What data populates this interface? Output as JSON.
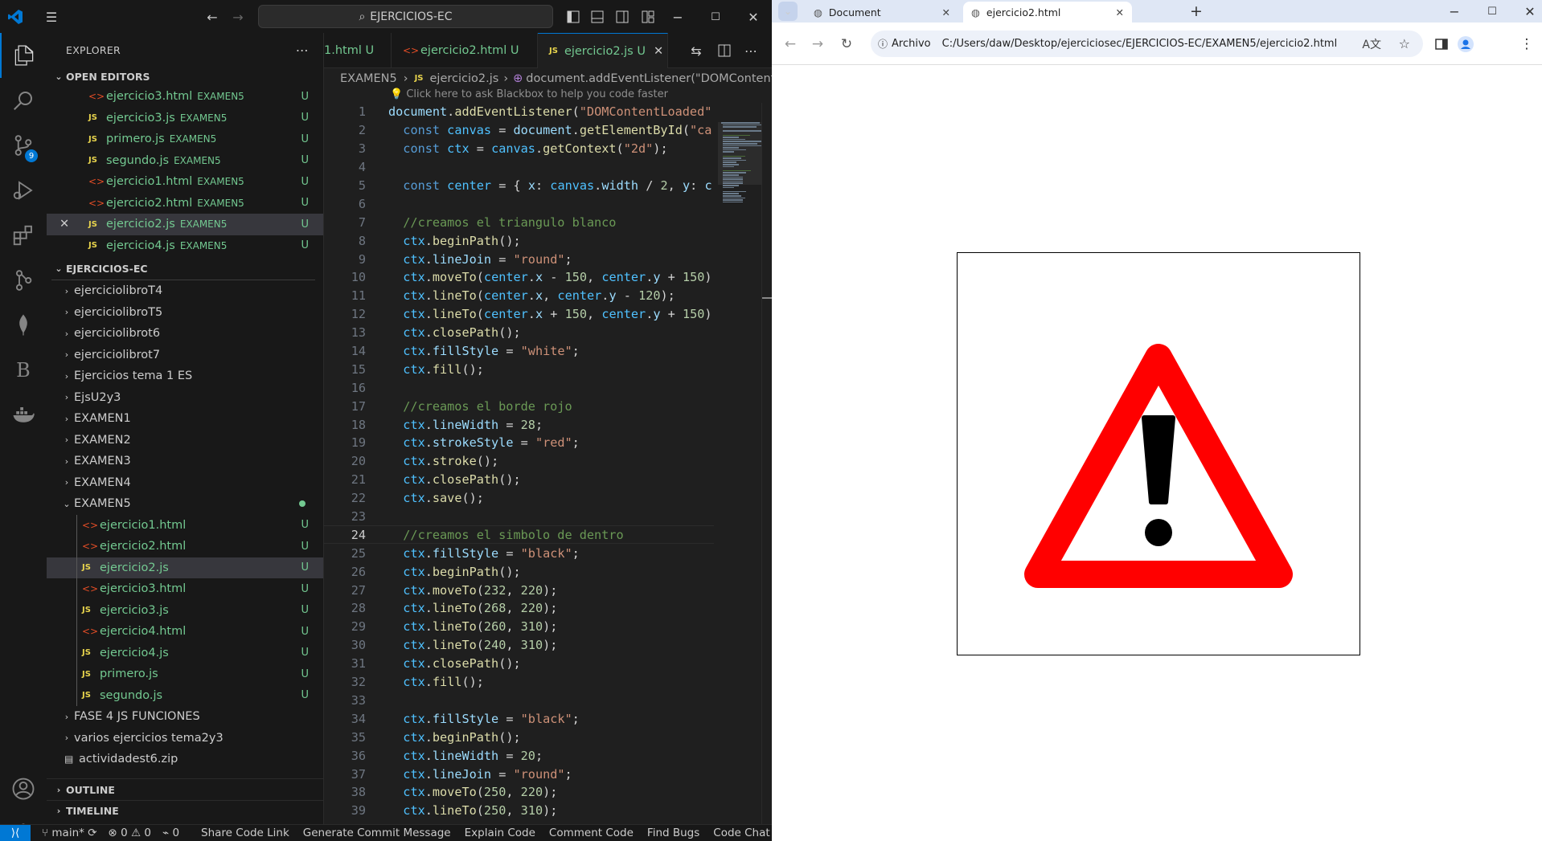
{
  "vscode": {
    "search_label": "EJERCICIOS-EC",
    "sidebar_title": "EXPLORER",
    "open_editors_title": "OPEN EDITORS",
    "open_editors": [
      {
        "name": "ejercicio3.html",
        "dir": "EXAMEN5",
        "type": "html",
        "status": "U"
      },
      {
        "name": "ejercicio3.js",
        "dir": "EXAMEN5",
        "type": "js",
        "status": "U"
      },
      {
        "name": "primero.js",
        "dir": "EXAMEN5",
        "type": "js",
        "status": "U"
      },
      {
        "name": "segundo.js",
        "dir": "EXAMEN5",
        "type": "js",
        "status": "U"
      },
      {
        "name": "ejercicio1.html",
        "dir": "EXAMEN5",
        "type": "html",
        "status": "U"
      },
      {
        "name": "ejercicio2.html",
        "dir": "EXAMEN5",
        "type": "html",
        "status": "U"
      },
      {
        "name": "ejercicio2.js",
        "dir": "EXAMEN5",
        "type": "js",
        "status": "U"
      },
      {
        "name": "ejercicio4.js",
        "dir": "EXAMEN5",
        "type": "js",
        "status": "U"
      }
    ],
    "workspace_title": "EJERCICIOS-EC",
    "folders": [
      "ejerciciolibroT4",
      "ejerciciolibroT5",
      "ejerciciolibrot6",
      "ejerciciolibrot7",
      "Ejercicios tema 1 ES",
      "EjsU2y3",
      "EXAMEN1",
      "EXAMEN2",
      "EXAMEN3",
      "EXAMEN4"
    ],
    "examen5": "EXAMEN5",
    "examen5_files": [
      {
        "name": "ejercicio1.html",
        "type": "html",
        "status": "U"
      },
      {
        "name": "ejercicio2.html",
        "type": "html",
        "status": "U"
      },
      {
        "name": "ejercicio2.js",
        "type": "js",
        "status": "U"
      },
      {
        "name": "ejercicio3.html",
        "type": "html",
        "status": "U"
      },
      {
        "name": "ejercicio3.js",
        "type": "js",
        "status": "U"
      },
      {
        "name": "ejercicio4.html",
        "type": "html",
        "status": "U"
      },
      {
        "name": "ejercicio4.js",
        "type": "js",
        "status": "U"
      },
      {
        "name": "primero.js",
        "type": "js",
        "status": "U"
      },
      {
        "name": "segundo.js",
        "type": "js",
        "status": "U"
      }
    ],
    "folders_after": [
      "FASE 4 JS FUNCIONES",
      "varios ejercicios tema2y3"
    ],
    "zip_file": "actividadest6.zip",
    "outline_title": "OUTLINE",
    "timeline_title": "TIMELINE",
    "source_control_badge": "9",
    "tabs": [
      {
        "name": "1.html",
        "status": "U",
        "type": "html"
      },
      {
        "name": "ejercicio2.html",
        "status": "U",
        "type": "html"
      },
      {
        "name": "ejercicio2.js",
        "status": "U",
        "type": "js"
      }
    ],
    "breadcrumb": {
      "folder": "EXAMEN5",
      "file": "ejercicio2.js",
      "symbol": "document.addEventListener(\"DOMContentL"
    },
    "hint": "Click here to ask Blackbox to help you code faster",
    "code_lines": [
      "document.addEventListener(\"DOMContentLoaded\"",
      "  const canvas = document.getElementById(\"ca",
      "  const ctx = canvas.getContext(\"2d\");",
      "",
      "  const center = { x: canvas.width / 2, y: c",
      "",
      "  //creamos el triangulo blanco",
      "  ctx.beginPath();",
      "  ctx.lineJoin = \"round\";",
      "  ctx.moveTo(center.x - 150, center.y + 150)",
      "  ctx.lineTo(center.x, center.y - 120);",
      "  ctx.lineTo(center.x + 150, center.y + 150)",
      "  ctx.closePath();",
      "  ctx.fillStyle = \"white\";",
      "  ctx.fill();",
      "",
      "  //creamos el borde rojo",
      "  ctx.lineWidth = 28;",
      "  ctx.strokeStyle = \"red\";",
      "  ctx.stroke();",
      "  ctx.closePath();",
      "  ctx.save();",
      "",
      "  //creamos el simbolo de dentro",
      "  ctx.fillStyle = \"black\";",
      "  ctx.beginPath();",
      "  ctx.moveTo(232, 220);",
      "  ctx.lineTo(268, 220);",
      "  ctx.lineTo(260, 310);",
      "  ctx.lineTo(240, 310);",
      "  ctx.closePath();",
      "  ctx.fill();",
      "",
      "  ctx.fillStyle = \"black\";",
      "  ctx.beginPath();",
      "  ctx.lineWidth = 20;",
      "  ctx.lineJoin = \"round\";",
      "  ctx.moveTo(250, 220);",
      "  ctx.lineTo(250, 310);"
    ],
    "current_line": 24,
    "status": {
      "branch": "main*",
      "errors": "0",
      "warnings": "0",
      "ports": "0",
      "items": [
        "Share Code Link",
        "Generate Commit Message",
        "Explain Code",
        "Comment Code",
        "Find Bugs",
        "Code Chat"
      ]
    }
  },
  "browser": {
    "tabs": [
      {
        "title": "Document"
      },
      {
        "title": "ejercicio2.html"
      }
    ],
    "site_info": "Archivo",
    "url": "C:/Users/daw/Desktop/ejerciciosec/EJERCICIOS-EC/EXAMEN5/ejercicio2.html"
  },
  "colors": {
    "accent": "#0078d4",
    "untracked": "#73c991",
    "sign_red": "#ff0000"
  }
}
